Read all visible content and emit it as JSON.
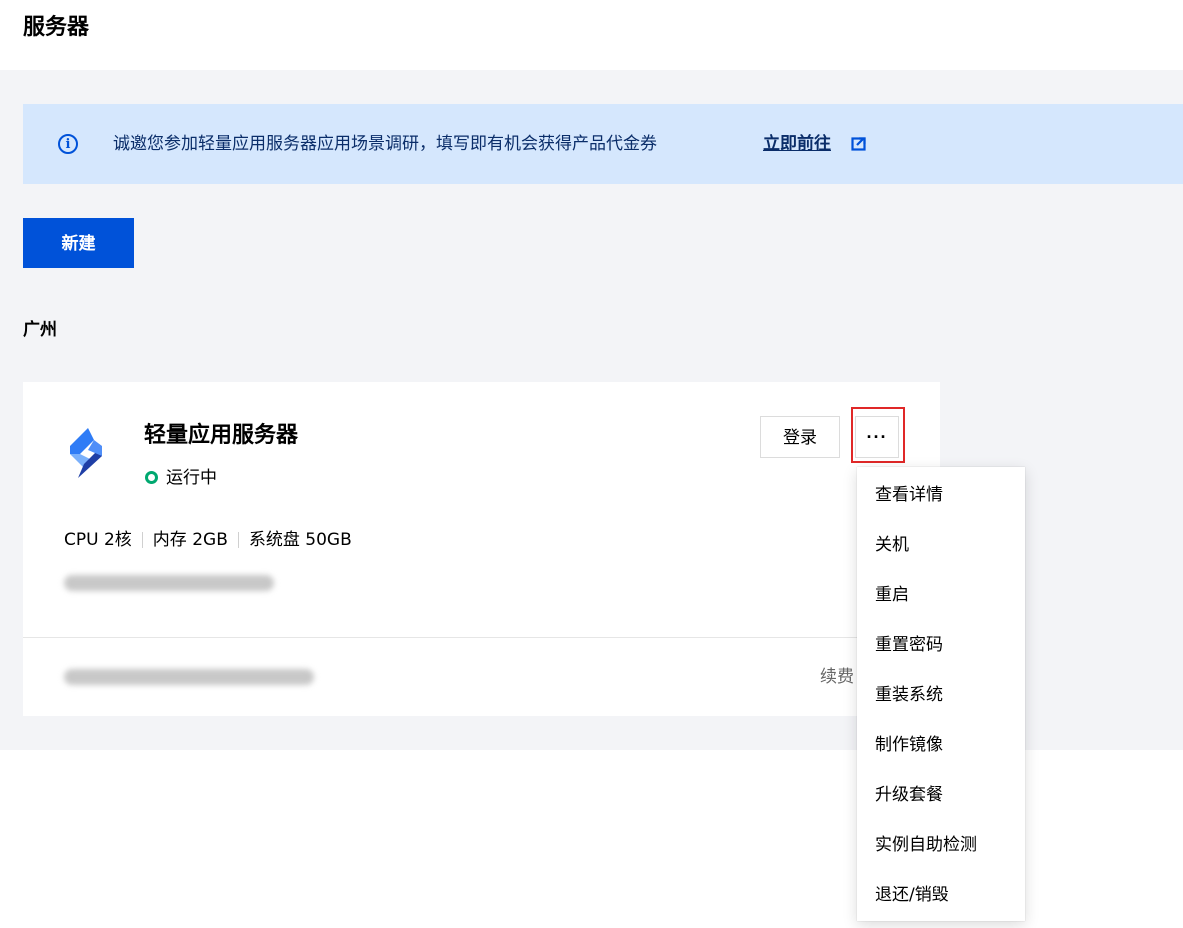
{
  "header": {
    "title": "服务器"
  },
  "notice": {
    "text": "诚邀您参加轻量应用服务器应用场景调研，填写即有机会获得产品代金券",
    "link_label": "立即前往"
  },
  "toolbar": {
    "new_label": "新建"
  },
  "region": {
    "label": "广州"
  },
  "card": {
    "name": "轻量应用服务器",
    "status": "运行中",
    "status_color": "#00a870",
    "login_label": "登录",
    "more_label": "···",
    "specs": {
      "cpu": "CPU 2核",
      "memory": "内存 2GB",
      "disk": "系统盘 50GB"
    },
    "renew_label": "续费"
  },
  "menu": {
    "items": [
      "查看详情",
      "关机",
      "重启",
      "重置密码",
      "重装系统",
      "制作镜像",
      "升级套餐",
      "实例自助检测",
      "退还/销毁"
    ]
  },
  "colors": {
    "primary": "#0052d9",
    "notice_bg": "#d5e7fd",
    "highlight": "#e02828"
  },
  "icons": {
    "notice": "info-icon",
    "link": "external-link-icon",
    "logo": "lighthouse-logo-icon",
    "status": "status-dot-icon"
  }
}
